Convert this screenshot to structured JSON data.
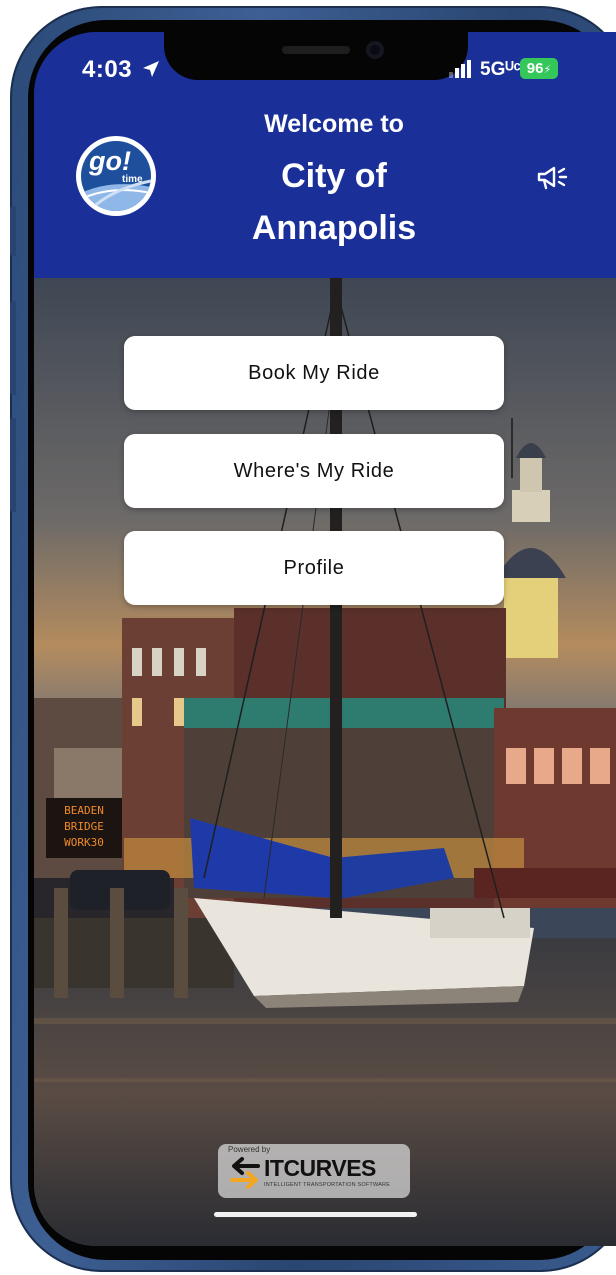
{
  "status_bar": {
    "time": "4:03",
    "network": "5Gᵁᶜ",
    "battery": "96"
  },
  "header": {
    "welcome_line": "Welcome to",
    "city_line1": "City of",
    "city_line2": "Annapolis",
    "logo_text": "go!",
    "logo_subtext": "time",
    "announcement_icon": "megaphone-icon",
    "background_color": "#1a2f98"
  },
  "menu": {
    "items": [
      {
        "label": "Book My Ride"
      },
      {
        "label": "Where's My Ride"
      },
      {
        "label": "Profile"
      }
    ]
  },
  "footer": {
    "powered_by": "Powered by",
    "brand": "ITCURVES",
    "tagline": "INTELLIGENT TRANSPORTATION SOFTWARE"
  },
  "colors": {
    "header_blue": "#1a2f98",
    "battery_green": "#34c759",
    "brand_orange": "#f4a623"
  },
  "sign_text": [
    "BEADEN",
    "BRIDGE",
    "WORK30"
  ]
}
